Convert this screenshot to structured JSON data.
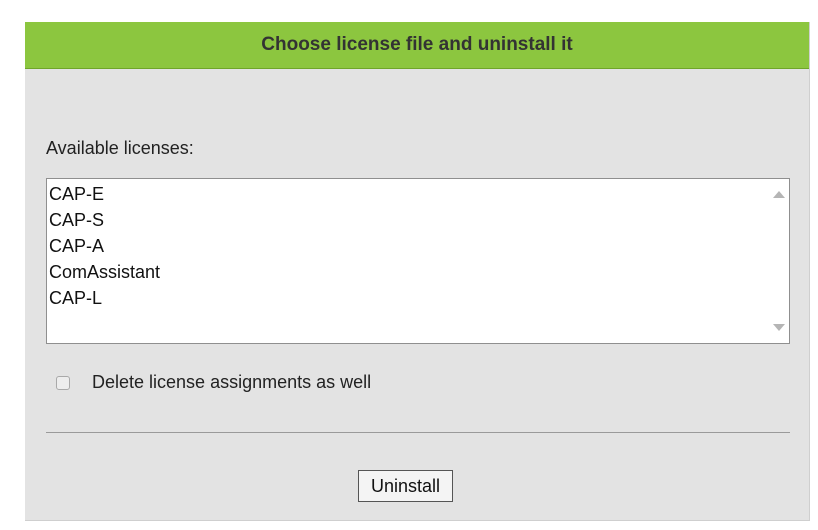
{
  "header": {
    "title": "Choose license file and uninstall it"
  },
  "licenses": {
    "label": "Available licenses:",
    "items": [
      "CAP-E",
      "CAP-S",
      "CAP-A",
      "ComAssistant",
      "CAP-L"
    ]
  },
  "options": {
    "delete_assignments_label": "Delete license assignments as well",
    "delete_assignments_checked": false
  },
  "actions": {
    "uninstall_label": "Uninstall"
  },
  "colors": {
    "header_bg": "#8cc63f",
    "panel_bg": "#e3e3e3"
  },
  "icons": {
    "scroll_up": "scroll-up-arrow-icon",
    "scroll_down": "scroll-down-arrow-icon"
  }
}
